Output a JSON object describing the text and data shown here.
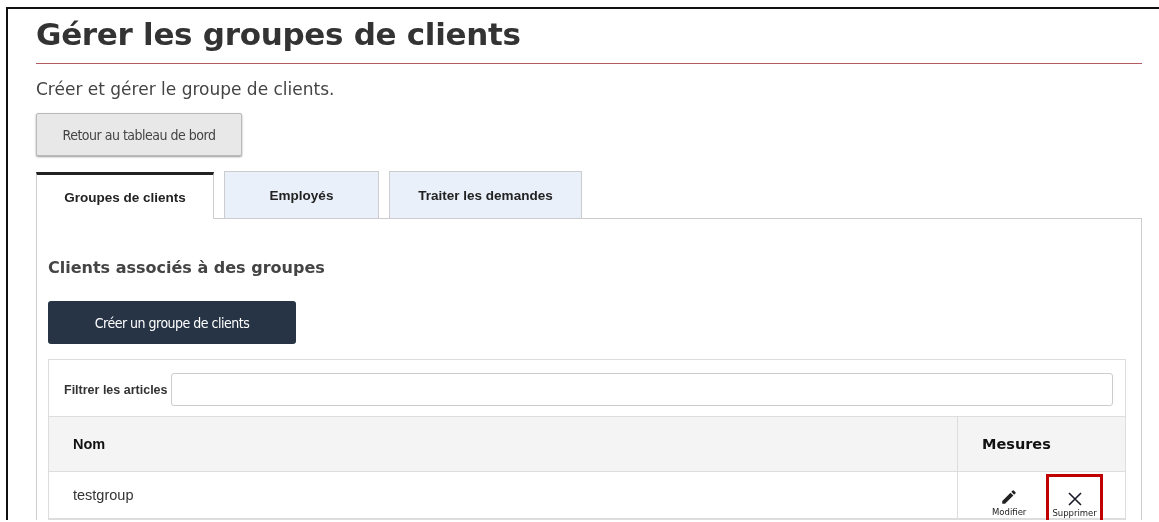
{
  "page": {
    "title": "Gérer les groupes de clients",
    "subtitle": "Créer et gérer le groupe de clients."
  },
  "back_button": "Retour au tableau de bord",
  "tabs": [
    {
      "label": "Groupes de clients",
      "selected": true
    },
    {
      "label": "Employés",
      "selected": false
    },
    {
      "label": "Traiter les demandes",
      "selected": false
    }
  ],
  "section_title": "Clients associés à des groupes",
  "create_button": "Créer un groupe de clients",
  "filter": {
    "label": "Filtrer les articles"
  },
  "table": {
    "columns": [
      "Nom",
      "Mesures"
    ],
    "rows": [
      {
        "name": "testgroup",
        "actions": [
          {
            "kind": "edit",
            "label": "Modifier",
            "highlighted": false
          },
          {
            "kind": "delete",
            "label": "Supprimer",
            "highlighted": true
          }
        ]
      }
    ]
  }
}
